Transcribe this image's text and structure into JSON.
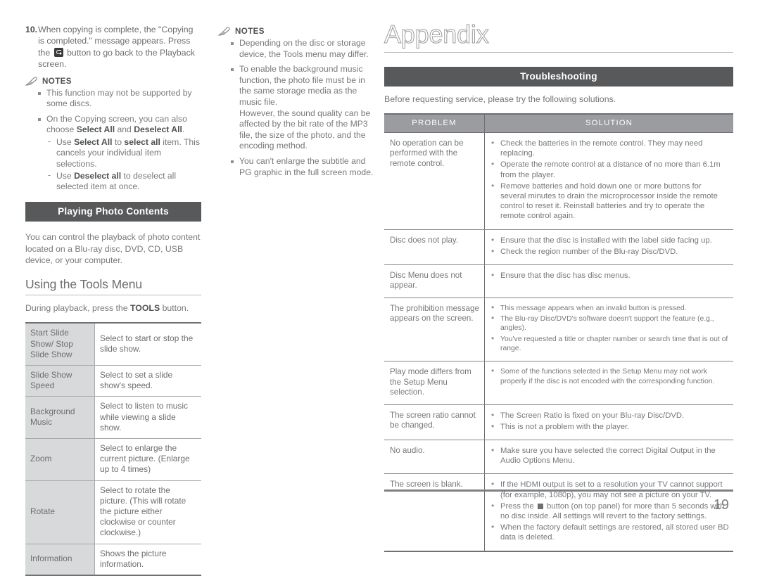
{
  "left_column": {
    "step": {
      "number": "10.",
      "text_before": "When copying is complete, the \"Copying is completed.\" message appears. Press the",
      "icon": "return-button-icon",
      "text_after": "button to go back to the Playback screen."
    },
    "notes_label": "NOTES",
    "notes_icon": "pencil-icon",
    "notes": [
      {
        "text": "This function may not be supported by some discs.",
        "sub": []
      },
      {
        "text_parts": [
          "On the Copying screen, you can also choose ",
          "Select All",
          " and ",
          "Deselect All",
          "."
        ],
        "sub": [
          [
            "Use ",
            "Select All",
            " to ",
            "select all",
            " item. This cancels your individual item selections."
          ],
          [
            "Use ",
            "Deselect all",
            " to deselect all selected item at once."
          ]
        ]
      }
    ],
    "section_bar": "Playing Photo Contents",
    "paragraph": "You can control the playback of photo content located on a Blu-ray disc, DVD, CD, USB device, or your computer.",
    "sub_heading": "Using the Tools Menu",
    "tools_intro_parts": [
      "During playback, press the ",
      "TOOLS",
      " button."
    ],
    "tools_table": [
      {
        "label": "Start Slide Show/ Stop Slide Show",
        "desc": "Select to start or stop the slide show."
      },
      {
        "label": "Slide Show Speed",
        "desc": "Select to set a slide show's speed."
      },
      {
        "label": "Background Music",
        "desc": "Select to listen to music while viewing a slide show."
      },
      {
        "label": "Zoom",
        "desc": "Select to enlarge the current picture. (Enlarge up to 4 times)"
      },
      {
        "label": "Rotate",
        "desc": "Select to rotate the picture. (This will rotate the picture either clockwise or counter clockwise.)"
      },
      {
        "label": "Information",
        "desc": "Shows the picture information."
      }
    ]
  },
  "mid_column": {
    "notes_label": "NOTES",
    "notes_icon": "pencil-icon",
    "notes": [
      "Depending on the disc or storage device, the Tools menu may differ.",
      "To enable the background music function, the photo file must be in the same storage media as the music file.\nHowever, the sound quality can be affected by the bit rate of the MP3 file, the size of the photo, and the encoding method.",
      "You can't enlarge the subtitle and PG graphic in the full screen mode."
    ]
  },
  "right_column": {
    "title": "Appendix",
    "section_bar": "Troubleshooting",
    "intro": "Before requesting service, please try the following solutions.",
    "table_headers": {
      "problem": "PROBLEM",
      "solution": "SOLUTION"
    },
    "rows": [
      {
        "problem": "No operation can be performed with the remote control.",
        "solutions": [
          "Check the batteries in the remote control. They may need replacing.",
          "Operate the remote control at a distance of no more than 6.1m from the player.",
          "Remove batteries and hold down one or more buttons for several minutes to drain the microprocessor inside the remote control to reset it. Reinstall batteries and try to operate the remote control again."
        ],
        "size": "normal"
      },
      {
        "problem": "Disc does not play.",
        "solutions": [
          "Ensure that the disc is installed with the label side facing up.",
          "Check the region number of the Blu-ray Disc/DVD."
        ],
        "size": "normal"
      },
      {
        "problem": "Disc Menu does not appear.",
        "solutions": [
          "Ensure that the disc has disc menus."
        ],
        "size": "normal"
      },
      {
        "problem": "The prohibition message appears on the screen.",
        "solutions": [
          "This message appears when an invalid button is pressed.",
          "The Blu-ray Disc/DVD's software doesn't support the feature (e.g., angles).",
          "You've requested a title or chapter number or search time that is out of range."
        ],
        "size": "small"
      },
      {
        "problem": "Play mode differs from the Setup Menu selection.",
        "solutions": [
          "Some of the functions selected in the Setup Menu may not work properly if the disc is not encoded with the corresponding function."
        ],
        "size": "small"
      },
      {
        "problem": "The screen ratio cannot be changed.",
        "solutions": [
          "The Screen Ratio is fixed on your Blu-ray Disc/DVD.",
          "This is not a problem with the player."
        ],
        "size": "normal"
      },
      {
        "problem": "No audio.",
        "solutions": [
          "Make sure you have selected the correct Digital Output in the Audio Options Menu."
        ],
        "size": "normal"
      },
      {
        "problem": "The screen is blank.",
        "solutions": [
          "If the HDMI output is set to a resolution your TV cannot support (for example, 1080p), you may not see a picture on your TV.",
          "Press the [panel-button-icon] button (on top panel) for more than 5 seconds with no disc inside. All settings will revert to the factory settings.",
          "When the factory default settings are restored, all stored user BD data is deleted."
        ],
        "size": "normal"
      }
    ]
  },
  "footer": {
    "page_number": "19"
  },
  "colors": {
    "section_bar_bg": "#58595b",
    "table_header_bg": "#9b9c9f",
    "tool_label_bg": "#d8d9da",
    "body_text": "#76787b",
    "rule": "#6f7072"
  }
}
